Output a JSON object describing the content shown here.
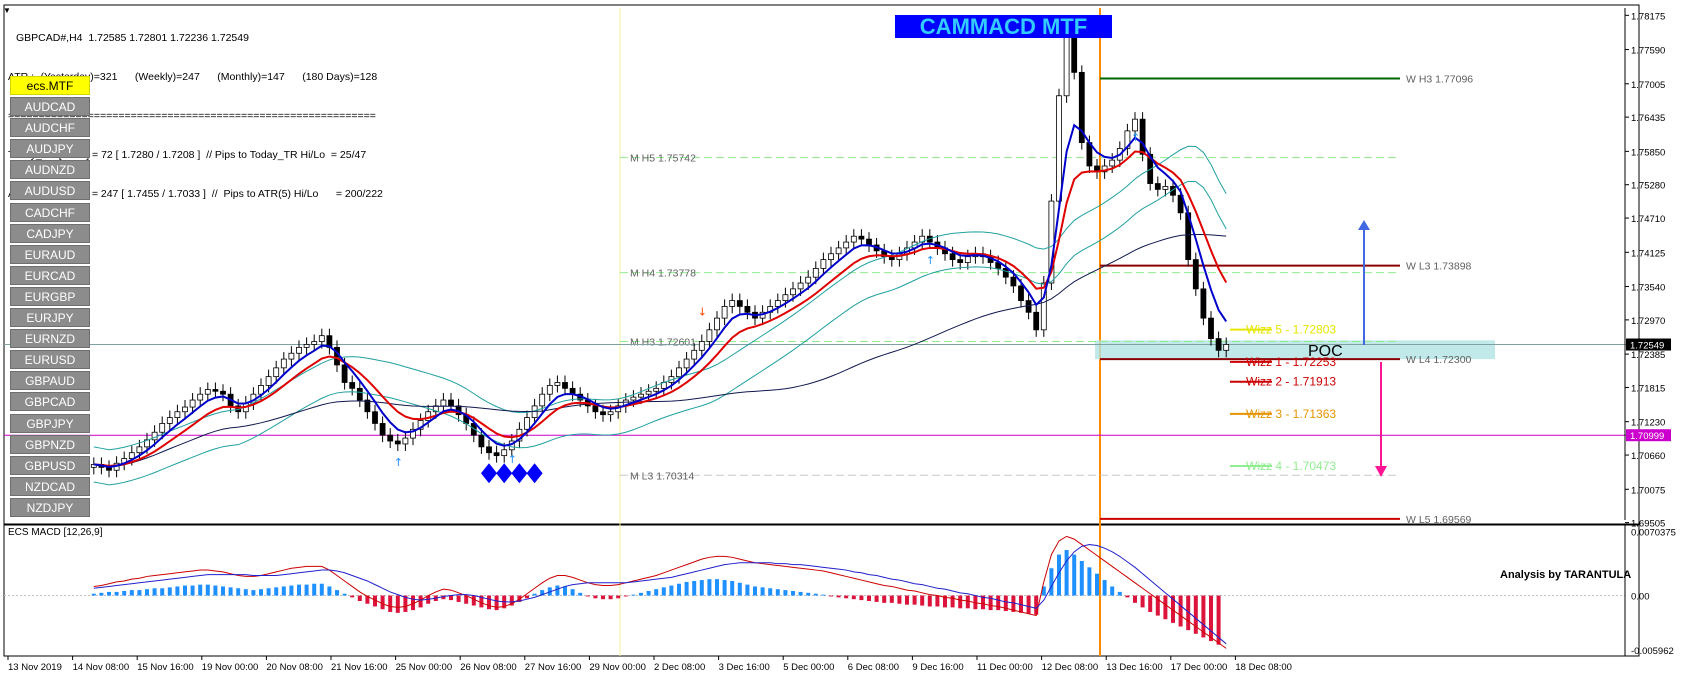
{
  "header": {
    "symbol_line": "GBPCAD#,H4  1.72585 1.72801 1.72236 1.72549",
    "atr_line": "ATR :- (Yesterday)=321      (Weekly)=247      (Monthly)=147      (180 Days)=128",
    "separator": "============================================================",
    "today_tr_line": "Today_TR [Hi/Lo] = 72 [ 1.7280 / 1.7208 ]  // Pips to Today_TR Hi/Lo  = 25/47",
    "atr5_line": "ATR(5)      [Hi/Lo] = 247 [ 1.7455 / 1.7033 ]  //  Pips to ATR(5) Hi/Lo      = 200/222"
  },
  "symbols": {
    "active": "ecs.MTF",
    "list": [
      "AUDCAD",
      "AUDCHF",
      "AUDJPY",
      "AUDNZD",
      "AUDUSD",
      "CADCHF",
      "CADJPY",
      "EURAUD",
      "EURCAD",
      "EURGBP",
      "EURJPY",
      "EURNZD",
      "EURUSD",
      "GBPAUD",
      "GBPCAD",
      "GBPJPY",
      "GBPNZD",
      "GBPUSD",
      "NZDCAD",
      "NZDJPY"
    ]
  },
  "title": "CAMMACD MTF",
  "colors": {
    "banner_bg": "#0000ff",
    "banner_text": "#33ccff",
    "red_ma": "#e00000",
    "blue_ma": "#0000cc",
    "envelope": "#20a0a0",
    "vertical_marker": "#ff8c00",
    "magenta_line": "#cc00cc",
    "poc_fill": "#b2e4e4"
  },
  "chart_data": [
    {
      "type": "candlestick",
      "symbol": "GBPCAD#",
      "timeframe": "H4",
      "ylim": [
        1.6955,
        1.783
      ],
      "y_ticks": [
        "1.78175",
        "1.77590",
        "1.77005",
        "1.76435",
        "1.75850",
        "1.75280",
        "1.74710",
        "1.74125",
        "1.73540",
        "1.72970",
        "1.72385",
        "1.71815",
        "1.71230",
        "1.70660",
        "1.70075",
        "1.69505"
      ],
      "x_labels": [
        "13 Nov 2019",
        "14 Nov 08:00",
        "15 Nov 16:00",
        "19 Nov 00:00",
        "20 Nov 08:00",
        "21 Nov 16:00",
        "25 Nov 00:00",
        "26 Nov 08:00",
        "27 Nov 16:00",
        "29 Nov 00:00",
        "2 Dec 08:00",
        "3 Dec 16:00",
        "5 Dec 00:00",
        "6 Dec 08:00",
        "9 Dec 16:00",
        "11 Dec 00:00",
        "12 Dec 08:00",
        "13 Dec 16:00",
        "17 Dec 00:00",
        "18 Dec 08:00"
      ],
      "closes": [
        1.705,
        1.7045,
        1.704,
        1.7052,
        1.706,
        1.707,
        1.708,
        1.7092,
        1.7105,
        1.712,
        1.713,
        1.714,
        1.7148,
        1.716,
        1.717,
        1.7178,
        1.7175,
        1.717,
        1.715,
        1.714,
        1.7155,
        1.717,
        1.7185,
        1.72,
        1.7215,
        1.723,
        1.724,
        1.725,
        1.7255,
        1.726,
        1.727,
        1.725,
        1.722,
        1.719,
        1.718,
        1.716,
        1.714,
        1.712,
        1.71,
        1.709,
        1.7085,
        1.7095,
        1.711,
        1.7125,
        1.714,
        1.715,
        1.716,
        1.715,
        1.7135,
        1.712,
        1.71,
        1.708,
        1.707,
        1.7065,
        1.7075,
        1.709,
        1.711,
        1.713,
        1.715,
        1.717,
        1.7185,
        1.719,
        1.718,
        1.717,
        1.716,
        1.715,
        1.714,
        1.7135,
        1.714,
        1.715,
        1.716,
        1.7165,
        1.717,
        1.7175,
        1.718,
        1.719,
        1.72,
        1.7215,
        1.723,
        1.7245,
        1.726,
        1.728,
        1.73,
        1.732,
        1.733,
        1.732,
        1.731,
        1.73,
        1.731,
        1.732,
        1.733,
        1.734,
        1.735,
        1.736,
        1.737,
        1.7385,
        1.74,
        1.741,
        1.742,
        1.743,
        1.744,
        1.7435,
        1.7425,
        1.7415,
        1.7405,
        1.74,
        1.741,
        1.742,
        1.743,
        1.744,
        1.743,
        1.742,
        1.741,
        1.74,
        1.7395,
        1.7405,
        1.741,
        1.7405,
        1.7395,
        1.7385,
        1.737,
        1.7355,
        1.733,
        1.731,
        1.728,
        1.736,
        1.75,
        1.768,
        1.778,
        1.772,
        1.76,
        1.756,
        1.755,
        1.756,
        1.757,
        1.759,
        1.762,
        1.764,
        1.758,
        1.753,
        1.752,
        1.7525,
        1.751,
        1.748,
        1.74,
        1.735,
        1.73,
        1.7265,
        1.7245,
        1.7255
      ],
      "price_levels": [
        {
          "label": "W  H3 1.77096",
          "value": 1.77096,
          "color": "#006400"
        },
        {
          "label": "W  L3 1.73898",
          "value": 1.73898,
          "color": "#8b0000"
        },
        {
          "label": "W  L4 1.72300",
          "value": 1.723,
          "color": "#8b0000"
        },
        {
          "label": "W  L5 1.69569",
          "value": 1.69569,
          "color": "#cc0000"
        },
        {
          "label": "M  H5 1.75742",
          "value": 1.75742,
          "color": "#90ee90"
        },
        {
          "label": "M  H4 1.73778",
          "value": 1.73778,
          "color": "#90ee90"
        },
        {
          "label": "M  H3 1.72601",
          "value": 1.72601,
          "color": "#90ee90"
        },
        {
          "label": "M  L3 1.70314",
          "value": 1.70314,
          "color": "#c8c8c8"
        }
      ],
      "wizz_levels": [
        {
          "label": "Wizz 5 - 1.72803",
          "value": 1.72803,
          "color": "#e6e600"
        },
        {
          "label": "Wizz 1 - 1.72253",
          "value": 1.72253,
          "color": "#cc0000"
        },
        {
          "label": "Wizz 2 - 1.71913",
          "value": 1.71913,
          "color": "#cc0000"
        },
        {
          "label": "Wizz 3 - 1.71363",
          "value": 1.71363,
          "color": "#e69500"
        },
        {
          "label": "Wizz 4 - 1.70473",
          "value": 1.70473,
          "color": "#90ee90"
        }
      ],
      "poc_label": "POC",
      "poc_zone": [
        1.723,
        1.7262
      ],
      "current_price": "1.72549",
      "current_price_value": 1.72549,
      "magenta_level": "1.70999",
      "magenta_level_value": 1.70999,
      "annotation": "Analysis by TARANTULA"
    },
    {
      "type": "macd",
      "title": "ECS MACD [12,26,9]",
      "y_ticks": [
        "0.0070375",
        "0.00",
        "-0.005962"
      ],
      "ylim": [
        -0.0062,
        0.0072
      ],
      "histogram": [
        0.0002,
        0.0003,
        0.0004,
        0.0004,
        0.0005,
        0.0006,
        0.0006,
        0.0007,
        0.0008,
        0.0008,
        0.0009,
        0.001,
        0.0011,
        0.0011,
        0.0012,
        0.0012,
        0.0011,
        0.001,
        0.0009,
        0.0008,
        0.0007,
        0.0006,
        0.0007,
        0.0008,
        0.0009,
        0.001,
        0.0011,
        0.0012,
        0.0012,
        0.0013,
        0.0013,
        0.001,
        0.0006,
        0.0002,
        -0.0002,
        -0.0006,
        -0.0009,
        -0.0012,
        -0.0015,
        -0.0018,
        -0.0019,
        -0.0018,
        -0.0016,
        -0.0013,
        -0.0009,
        -0.0006,
        -0.0004,
        -0.0005,
        -0.0007,
        -0.0009,
        -0.0011,
        -0.0013,
        -0.0015,
        -0.0016,
        -0.0014,
        -0.0011,
        -0.0007,
        -0.0003,
        0.0002,
        0.0006,
        0.0009,
        0.0011,
        0.001,
        0.0007,
        0.0003,
        -0.0001,
        -0.0003,
        -0.0004,
        -0.0004,
        -0.0003,
        -0.0001,
        0.0001,
        0.0003,
        0.0005,
        0.0007,
        0.0009,
        0.0011,
        0.0013,
        0.0015,
        0.0016,
        0.0017,
        0.0018,
        0.0018,
        0.0017,
        0.0016,
        0.0014,
        0.0012,
        0.001,
        0.0009,
        0.0008,
        0.0007,
        0.0006,
        0.0005,
        0.0004,
        0.0003,
        0.0002,
        0.0001,
        -0.0001,
        -0.0002,
        -0.0003,
        -0.0004,
        -0.0005,
        -0.0006,
        -0.0007,
        -0.0008,
        -0.0008,
        -0.0009,
        -0.001,
        -0.001,
        -0.0011,
        -0.0012,
        -0.0012,
        -0.0013,
        -0.0013,
        -0.0014,
        -0.0014,
        -0.0015,
        -0.0015,
        -0.0016,
        -0.0016,
        -0.0017,
        -0.0018,
        -0.0019,
        -0.002,
        -0.0021,
        0.001,
        0.003,
        0.0045,
        0.005,
        0.0045,
        0.0038,
        0.0031,
        0.0024,
        0.0017,
        0.001,
        0.0004,
        -0.0002,
        -0.0008,
        -0.0013,
        -0.0018,
        -0.0022,
        -0.0026,
        -0.003,
        -0.0034,
        -0.0038,
        -0.0042,
        -0.0046,
        -0.005,
        -0.0054
      ],
      "macd_line": [
        0.001,
        0.0011,
        0.0013,
        0.0015,
        0.0016,
        0.0018,
        0.0019,
        0.0021,
        0.0022,
        0.0023,
        0.0024,
        0.0025,
        0.0026,
        0.0027,
        0.0028,
        0.0028,
        0.0027,
        0.0026,
        0.0024,
        0.0022,
        0.0021,
        0.0021,
        0.0022,
        0.0024,
        0.0026,
        0.0028,
        0.003,
        0.0031,
        0.0032,
        0.0032,
        0.0032,
        0.0028,
        0.0022,
        0.0016,
        0.001,
        0.0004,
        -0.0001,
        -0.0005,
        -0.0009,
        -0.0012,
        -0.0013,
        -0.0012,
        -0.0009,
        -0.0005,
        0.0,
        0.0004,
        0.0007,
        0.0006,
        0.0003,
        0.0,
        -0.0004,
        -0.0008,
        -0.0011,
        -0.0013,
        -0.0012,
        -0.0009,
        -0.0004,
        0.0002,
        0.0008,
        0.0014,
        0.0019,
        0.0022,
        0.0022,
        0.002,
        0.0017,
        0.0014,
        0.0012,
        0.0011,
        0.0011,
        0.0012,
        0.0014,
        0.0016,
        0.0018,
        0.002,
        0.0022,
        0.0025,
        0.0028,
        0.0031,
        0.0034,
        0.0037,
        0.004,
        0.0042,
        0.0043,
        0.0043,
        0.0042,
        0.004,
        0.0038,
        0.0036,
        0.0035,
        0.0034,
        0.0033,
        0.0032,
        0.0031,
        0.003,
        0.0029,
        0.0028,
        0.0027,
        0.0025,
        0.0023,
        0.0021,
        0.0019,
        0.0017,
        0.0015,
        0.0013,
        0.0011,
        0.001,
        0.0008,
        0.0006,
        0.0005,
        0.0003,
        0.0001,
        0.0,
        -0.0002,
        -0.0003,
        -0.0005,
        -0.0006,
        -0.0008,
        -0.0009,
        -0.0011,
        -0.0012,
        -0.0014,
        -0.0016,
        -0.0018,
        -0.002,
        -0.0022,
        0.0015,
        0.0045,
        0.006,
        0.0065,
        0.0062,
        0.0056,
        0.005,
        0.0044,
        0.0038,
        0.0032,
        0.0026,
        0.002,
        0.0014,
        0.0008,
        0.0002,
        -0.0004,
        -0.001,
        -0.0016,
        -0.0022,
        -0.0028,
        -0.0034,
        -0.004,
        -0.0046,
        -0.0052,
        -0.0058
      ],
      "signal_line": [
        0.0008,
        0.0009,
        0.001,
        0.0011,
        0.0012,
        0.0013,
        0.0014,
        0.0015,
        0.0016,
        0.0017,
        0.0018,
        0.0019,
        0.002,
        0.0021,
        0.0022,
        0.0023,
        0.0023,
        0.0023,
        0.0023,
        0.0023,
        0.0023,
        0.0022,
        0.0022,
        0.0022,
        0.0022,
        0.0023,
        0.0024,
        0.0025,
        0.0026,
        0.0027,
        0.0028,
        0.0028,
        0.0027,
        0.0025,
        0.0022,
        0.0019,
        0.0016,
        0.0012,
        0.0008,
        0.0004,
        0.0001,
        -0.0002,
        -0.0004,
        -0.0005,
        -0.0004,
        -0.0003,
        -0.0001,
        0.0,
        0.0001,
        0.0001,
        0.0,
        -0.0002,
        -0.0004,
        -0.0006,
        -0.0007,
        -0.0007,
        -0.0006,
        -0.0004,
        -0.0002,
        0.0001,
        0.0004,
        0.0007,
        0.001,
        0.0012,
        0.0013,
        0.0014,
        0.0014,
        0.0014,
        0.0014,
        0.0014,
        0.0014,
        0.0015,
        0.0016,
        0.0017,
        0.0018,
        0.0019,
        0.002,
        0.0022,
        0.0024,
        0.0026,
        0.0028,
        0.003,
        0.0032,
        0.0034,
        0.0035,
        0.0036,
        0.0036,
        0.0036,
        0.0036,
        0.0036,
        0.0035,
        0.0035,
        0.0034,
        0.0034,
        0.0033,
        0.0032,
        0.0031,
        0.003,
        0.0029,
        0.0028,
        0.0026,
        0.0025,
        0.0023,
        0.0022,
        0.002,
        0.0018,
        0.0017,
        0.0015,
        0.0013,
        0.0012,
        0.001,
        0.0008,
        0.0007,
        0.0005,
        0.0003,
        0.0002,
        0.0,
        -0.0002,
        -0.0003,
        -0.0005,
        -0.0007,
        -0.0008,
        -0.001,
        -0.0012,
        -0.0014,
        -0.0005,
        0.001,
        0.0025,
        0.0038,
        0.0048,
        0.0054,
        0.0056,
        0.0055,
        0.0052,
        0.0048,
        0.0043,
        0.0037,
        0.0031,
        0.0024,
        0.0017,
        0.001,
        0.0003,
        -0.0004,
        -0.0011,
        -0.0018,
        -0.0025,
        -0.0032,
        -0.0039,
        -0.0046,
        -0.0053
      ]
    }
  ]
}
